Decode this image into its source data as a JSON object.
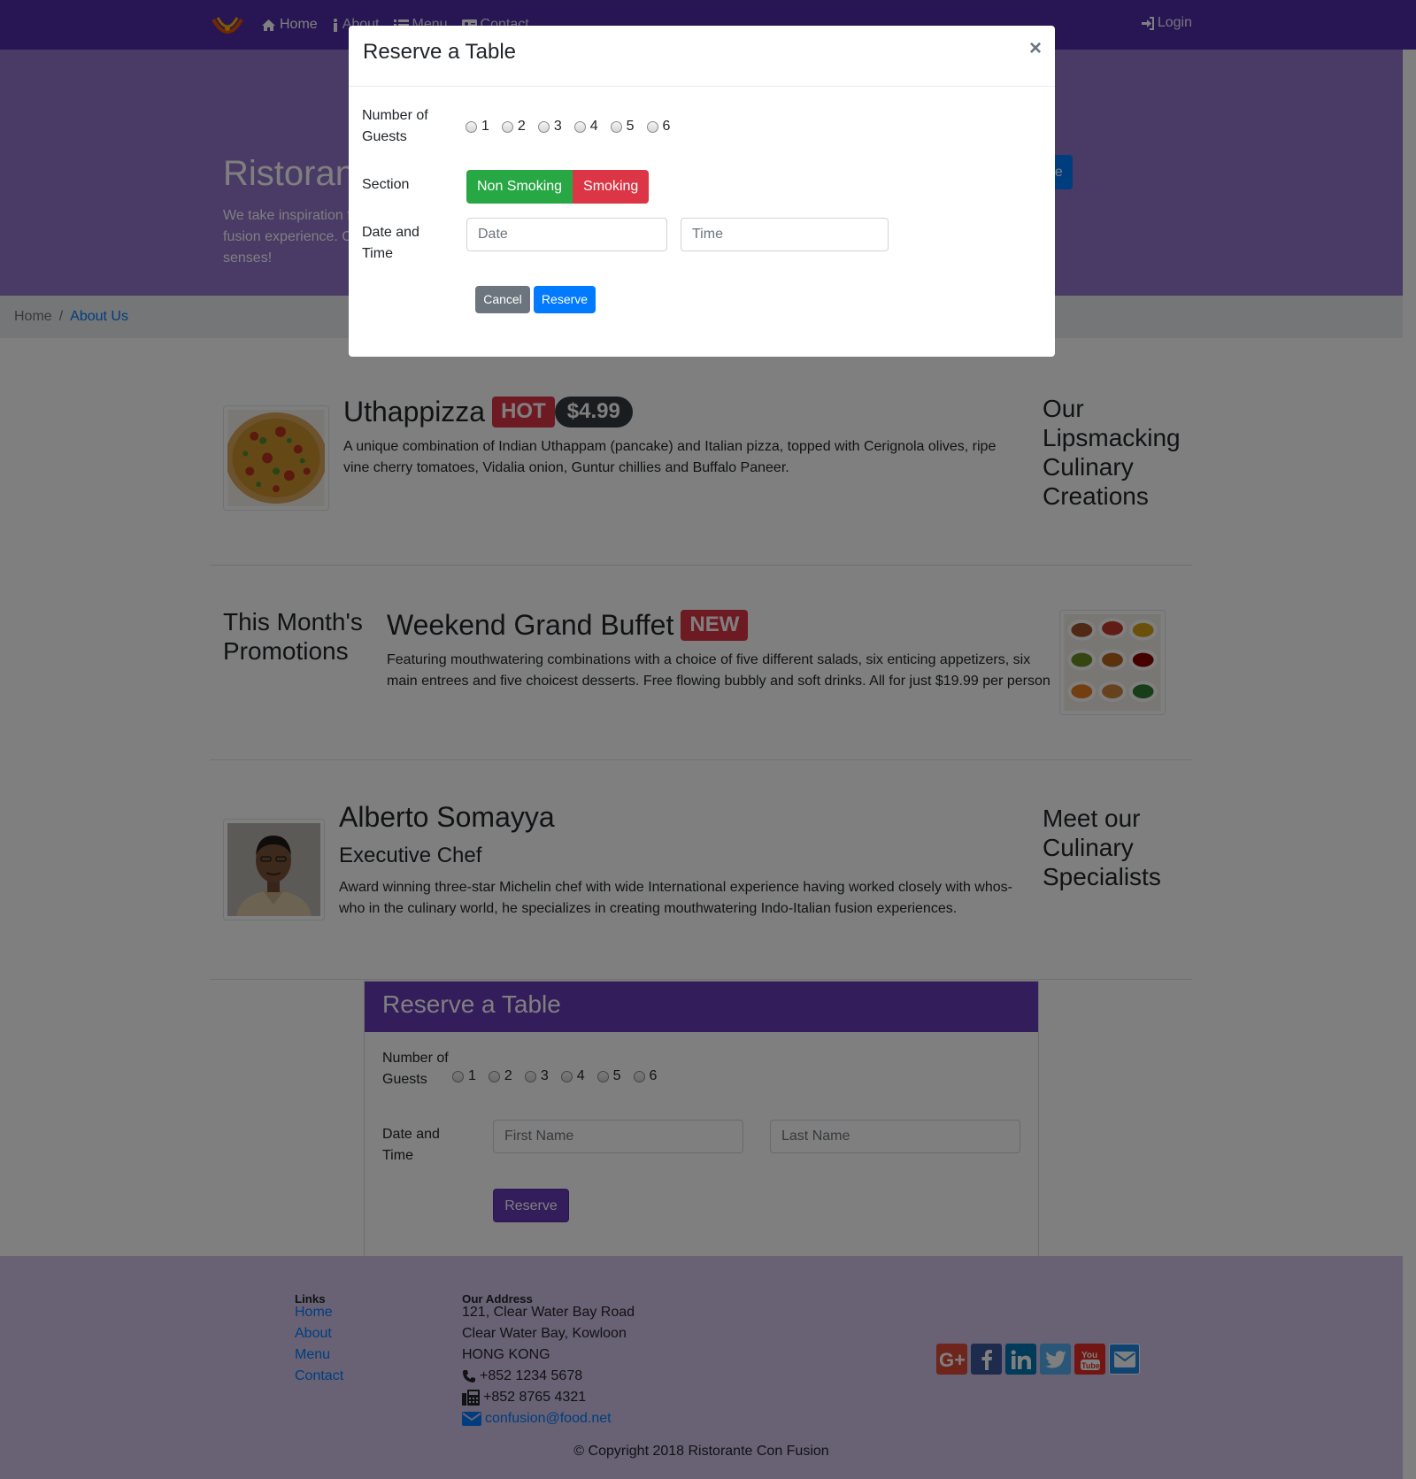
{
  "nav": {
    "logo": "ristorante-logo",
    "items": [
      {
        "label": "Home",
        "icon": "home-icon"
      },
      {
        "label": "About",
        "icon": "info-icon"
      },
      {
        "label": "Menu",
        "icon": "list-icon"
      },
      {
        "label": "Contact",
        "icon": "address-card-icon"
      }
    ],
    "login": "Login"
  },
  "jumbotron": {
    "title": "Ristorante con Fusion",
    "text": "We take inspiration from the World's best cuisines, and create a unique fusion experience. Our lipsmacking creations will tickle your culinary senses!",
    "button": "Reserve Table"
  },
  "breadcrumb": {
    "home": "Home",
    "separator": "/",
    "current": "About Us"
  },
  "dish": {
    "name": "Uthappizza",
    "badge": "HOT",
    "price": "$4.99",
    "description": "A unique combination of Indian Uthappam (pancake) and Italian pizza, topped with Cerignola olives, ripe vine cherry tomatoes, Vidalia onion, Guntur chillies and Buffalo Paneer.",
    "side_heading": "Our Lipsmacking Culinary Creations"
  },
  "promotion": {
    "side_heading": "This Month's Promotions",
    "name": "Weekend Grand Buffet",
    "badge": "NEW",
    "description": "Featuring mouthwatering combinations with a choice of five different salads, six enticing appetizers, six main entrees and five choicest desserts. Free flowing bubbly and soft drinks. All for just $19.99 per person"
  },
  "leader": {
    "name": "Alberto Somayya",
    "designation": "Executive Chef",
    "description": "Award winning three-star Michelin chef with wide International experience having worked closely with whos-who in the culinary world, he specializes in creating mouthwatering Indo-Italian fusion experiences.",
    "side_heading": "Meet our Culinary Specialists"
  },
  "reserve_card": {
    "title": "Reserve a Table",
    "guests_label": "Number of Guests",
    "guest_options": [
      "1",
      "2",
      "3",
      "4",
      "5",
      "6"
    ],
    "datetime_label": "Date and Time",
    "first_name_placeholder": "First Name",
    "last_name_placeholder": "Last Name",
    "submit": "Reserve"
  },
  "footer": {
    "links_heading": "Links",
    "links": [
      "Home",
      "About",
      "Menu",
      "Contact"
    ],
    "address_heading": "Our Address",
    "address_lines": [
      "121, Clear Water Bay Road",
      "Clear Water Bay, Kowloon",
      "HONG KONG"
    ],
    "phone": "+852 1234 5678",
    "fax": "+852 8765 4321",
    "email": "confusion@food.net",
    "social": [
      "google-plus-icon",
      "facebook-icon",
      "linkedin-icon",
      "twitter-icon",
      "youtube-icon",
      "email-icon"
    ],
    "copyright": "© Copyright 2018 Ristorante Con Fusion"
  },
  "modal": {
    "title": "Reserve a Table",
    "close": "×",
    "guests_label": "Number of Guests",
    "guest_options": [
      "1",
      "2",
      "3",
      "4",
      "5",
      "6"
    ],
    "section_label": "Section",
    "section_options": [
      "Non Smoking",
      "Smoking"
    ],
    "datetime_label": "Date and Time",
    "date_placeholder": "Date",
    "time_placeholder": "Time",
    "cancel": "Cancel",
    "reserve": "Reserve"
  },
  "colors": {
    "primary": "#512da8",
    "light": "#9575cd",
    "lightest": "#d1c4e9",
    "accent": "#673ab7",
    "success": "#28a745",
    "danger": "#dc3545",
    "link": "#007bff"
  }
}
